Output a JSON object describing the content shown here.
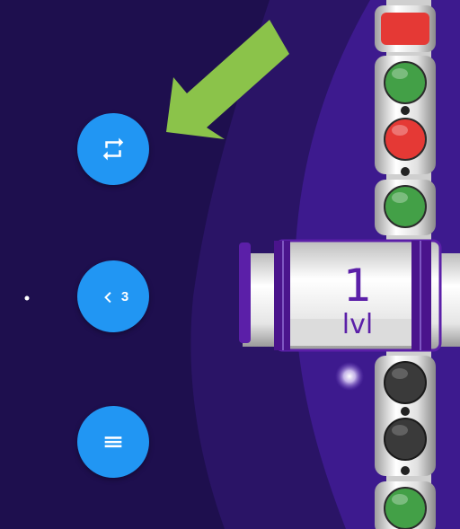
{
  "level": {
    "number": "1",
    "label": "lvl"
  },
  "controls": {
    "restart": {
      "icon": "repeat-icon"
    },
    "undo": {
      "icon": "chevron-left-icon",
      "count": "3"
    },
    "menu": {
      "icon": "menu-icon"
    }
  },
  "hint": {
    "icon": "arrow-pointer-icon",
    "color": "#8bc34a"
  },
  "lights": {
    "top": [
      "red",
      "green",
      "red",
      "green"
    ],
    "bottom": [
      "off",
      "off",
      "green"
    ]
  },
  "colors": {
    "background": "#1e0f4e",
    "panel": "#3d1a8e",
    "button": "#2196f3",
    "accent": "#5b1fa8",
    "red": "#e53935",
    "green": "#43a047",
    "off": "#3a3a3a"
  }
}
